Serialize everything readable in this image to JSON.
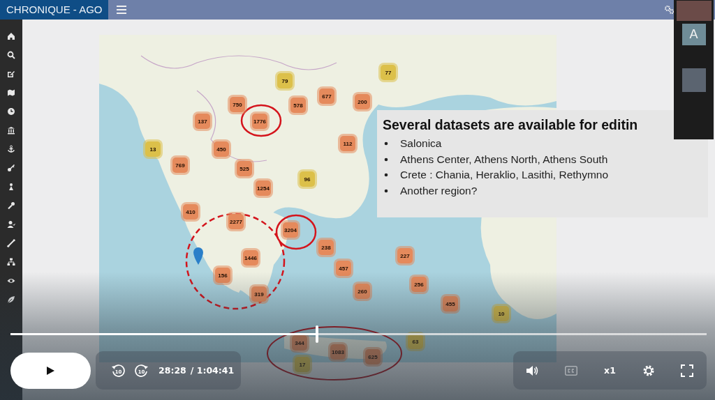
{
  "app": {
    "brand": "CHRONIQUE - AGO"
  },
  "map": {
    "clusters": [
      {
        "count": "79",
        "kind": "small"
      },
      {
        "count": "77",
        "kind": "small"
      },
      {
        "count": "750",
        "kind": "medium"
      },
      {
        "count": "578",
        "kind": "medium"
      },
      {
        "count": "677",
        "kind": "medium"
      },
      {
        "count": "200",
        "kind": "medium"
      },
      {
        "count": "1776",
        "kind": "medium"
      },
      {
        "count": "137",
        "kind": "medium"
      },
      {
        "count": "112",
        "kind": "medium"
      },
      {
        "count": "13",
        "kind": "small"
      },
      {
        "count": "450",
        "kind": "medium"
      },
      {
        "count": "769",
        "kind": "medium"
      },
      {
        "count": "525",
        "kind": "medium"
      },
      {
        "count": "96",
        "kind": "small"
      },
      {
        "count": "1254",
        "kind": "medium"
      },
      {
        "count": "410",
        "kind": "medium"
      },
      {
        "count": "2277",
        "kind": "medium"
      },
      {
        "count": "3204",
        "kind": "medium"
      },
      {
        "count": "238",
        "kind": "medium"
      },
      {
        "count": "1446",
        "kind": "medium"
      },
      {
        "count": "227",
        "kind": "medium"
      },
      {
        "count": "156",
        "kind": "medium"
      },
      {
        "count": "457",
        "kind": "medium"
      },
      {
        "count": "256",
        "kind": "medium"
      },
      {
        "count": "319",
        "kind": "medium"
      },
      {
        "count": "260",
        "kind": "medium"
      },
      {
        "count": "455",
        "kind": "medium"
      },
      {
        "count": "10",
        "kind": "small"
      },
      {
        "count": "63",
        "kind": "small"
      },
      {
        "count": "344",
        "kind": "medium"
      },
      {
        "count": "1083",
        "kind": "medium"
      },
      {
        "count": "625",
        "kind": "medium"
      },
      {
        "count": "17",
        "kind": "small"
      }
    ]
  },
  "slide": {
    "heading": "Several datasets are available for editin",
    "bullets": [
      "Salonica",
      "Athens Center, Athens North, Athens South",
      "Crete : Chania, Heraklio, Lasithi, Rethymno",
      "Another region?"
    ]
  },
  "participants": {
    "avatar_letter": "A"
  },
  "player": {
    "progress": {
      "level": 0.44
    },
    "skip_back": "10",
    "skip_forward": "10",
    "current_time": "28:28",
    "duration": "/ 1:04:41",
    "captions": {
      "disabled": true
    },
    "speed": "x1"
  }
}
